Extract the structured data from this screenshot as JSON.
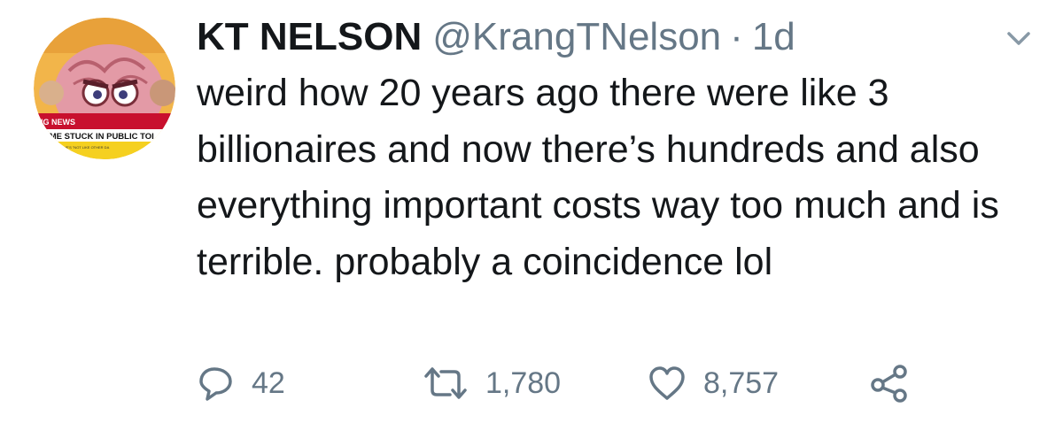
{
  "tweet": {
    "display_name": "KT NELSON",
    "handle": "@KrangTNelson",
    "separator": "·",
    "time": "1d",
    "text": "weird how 20 years ago there were like 3 billionaires and now there’s hundreds and also everything important costs way too much and is terrible. probably a coincidence lol",
    "avatar": {
      "icon": "avatar-image",
      "caption_top": "NG NEWS",
      "caption_main": "CAME STUCK IN PUBLIC TOI",
      "caption_small": "S HE'S \"NOT LIKE OTHER DA"
    }
  },
  "actions": {
    "reply_icon": "reply-icon",
    "reply_count": "42",
    "retweet_icon": "retweet-icon",
    "retweet_count": "1,780",
    "like_icon": "heart-icon",
    "like_count": "8,757",
    "share_icon": "share-icon"
  },
  "colors": {
    "text": "#14171a",
    "secondary": "#657786",
    "background": "#ffffff"
  }
}
